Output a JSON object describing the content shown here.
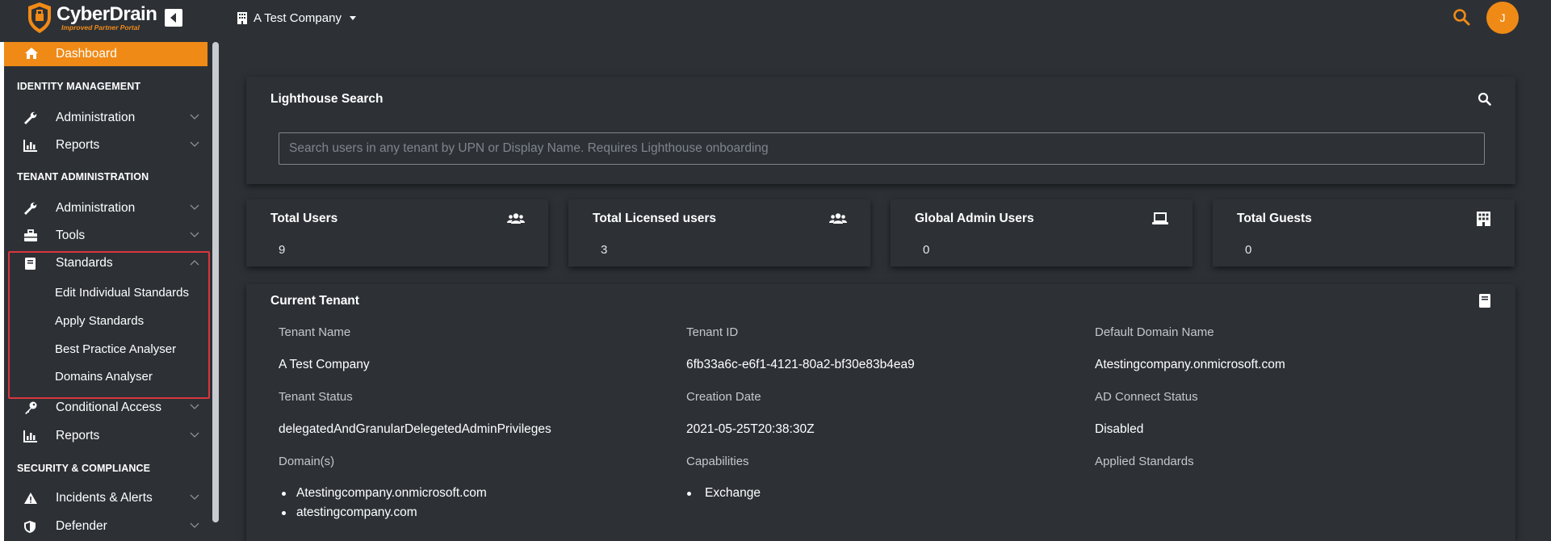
{
  "header": {
    "logo_name": "CyberDrain",
    "logo_tagline": "Improved Partner Portal",
    "tenant_name": "A Test Company",
    "avatar_initial": "J",
    "accent_color": "#f08a16"
  },
  "sidebar": {
    "dashboard": "Dashboard",
    "sections": {
      "identity": "IDENTITY MANAGEMENT",
      "tenant": "TENANT ADMINISTRATION",
      "security": "SECURITY & COMPLIANCE"
    },
    "items": {
      "id_admin": "Administration",
      "id_reports": "Reports",
      "tn_admin": "Administration",
      "tn_tools": "Tools",
      "tn_standards": "Standards",
      "std_edit": "Edit Individual Standards",
      "std_apply": "Apply Standards",
      "std_bpa": "Best Practice Analyser",
      "std_domains": "Domains Analyser",
      "tn_conditional": "Conditional Access",
      "tn_reports": "Reports",
      "sec_incidents": "Incidents & Alerts",
      "sec_defender": "Defender"
    }
  },
  "lighthouse": {
    "title": "Lighthouse Search",
    "placeholder": "Search users in any tenant by UPN or Display Name. Requires Lighthouse onboarding"
  },
  "stats": [
    {
      "title": "Total Users",
      "value": "9",
      "icon": "users-icon"
    },
    {
      "title": "Total Licensed users",
      "value": "3",
      "icon": "users-icon"
    },
    {
      "title": "Global Admin Users",
      "value": "0",
      "icon": "laptop-icon"
    },
    {
      "title": "Total Guests",
      "value": "0",
      "icon": "building-icon"
    }
  ],
  "current_tenant": {
    "title": "Current Tenant",
    "labels": {
      "tenant_name": "Tenant Name",
      "tenant_id": "Tenant ID",
      "default_domain": "Default Domain Name",
      "tenant_status": "Tenant Status",
      "creation_date": "Creation Date",
      "ad_connect": "AD Connect Status",
      "domains": "Domain(s)",
      "capabilities": "Capabilities",
      "applied_standards": "Applied Standards"
    },
    "values": {
      "tenant_name": "A Test Company",
      "tenant_id": "6fb33a6c-e6f1-4121-80a2-bf30e83b4ea9",
      "default_domain": "Atestingcompany.onmicrosoft.com",
      "tenant_status": "delegatedAndGranularDelegetedAdminPrivileges",
      "creation_date": "2021-05-25T20:38:30Z",
      "ad_connect": "Disabled"
    },
    "domains": [
      "Atestingcompany.onmicrosoft.com",
      "atestingcompany.com"
    ],
    "capabilities": [
      "Exchange"
    ]
  }
}
